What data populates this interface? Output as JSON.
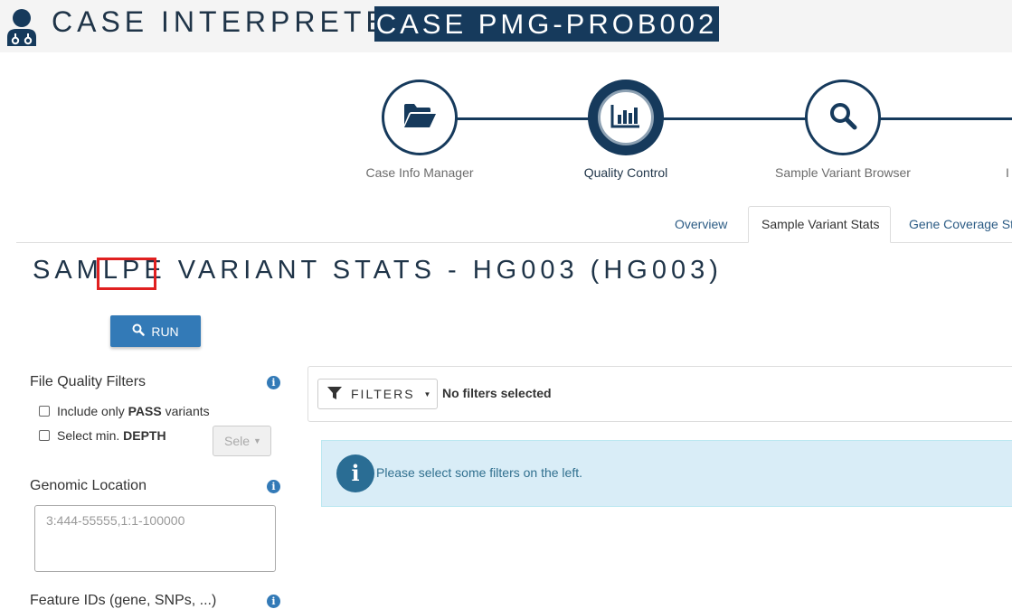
{
  "app": {
    "title": "CASE INTERPRETER",
    "case_badge": "CASE PMG-PROB002",
    "logo_icon": "user-doctor-icon"
  },
  "stepper": {
    "steps": [
      {
        "label": "Case Info Manager",
        "icon": "folder-open-icon",
        "active": false
      },
      {
        "label": "Quality Control",
        "icon": "bar-chart-icon",
        "active": true
      },
      {
        "label": "Sample Variant Browser",
        "icon": "search-icon",
        "active": false
      },
      {
        "label": "I",
        "icon": "",
        "active": false
      }
    ]
  },
  "tabs": [
    {
      "label": "Overview",
      "active": false
    },
    {
      "label": "Sample Variant Stats",
      "active": true
    },
    {
      "label": "Gene Coverage Sta",
      "active": false
    }
  ],
  "page": {
    "title_before": "SAM",
    "title_highlight": "LPE",
    "title_after": " VARIANT STATS - HG003 (HG003)"
  },
  "run_button": {
    "label": "RUN",
    "icon": "search-icon"
  },
  "filters_left": {
    "file_quality": {
      "title": "File Quality Filters",
      "pass_prefix": "Include only ",
      "pass_bold": "PASS",
      "pass_suffix": " variants",
      "depth_prefix": "Select min. ",
      "depth_bold": "DEPTH",
      "depth_select": "Select"
    },
    "genomic_location": {
      "title": "Genomic Location",
      "placeholder": "3:444-55555,1:1-100000"
    },
    "feature_ids": {
      "title": "Feature IDs (gene, SNPs, ...)"
    }
  },
  "filter_bar": {
    "button_label": "FILTERS",
    "status": "No filters selected"
  },
  "alert": {
    "text": "Please select some filters on the left."
  },
  "colors": {
    "brand_dark": "#163a5c",
    "primary": "#337ab7",
    "highlight": "#e02020",
    "alert_bg": "#d9edf7"
  }
}
